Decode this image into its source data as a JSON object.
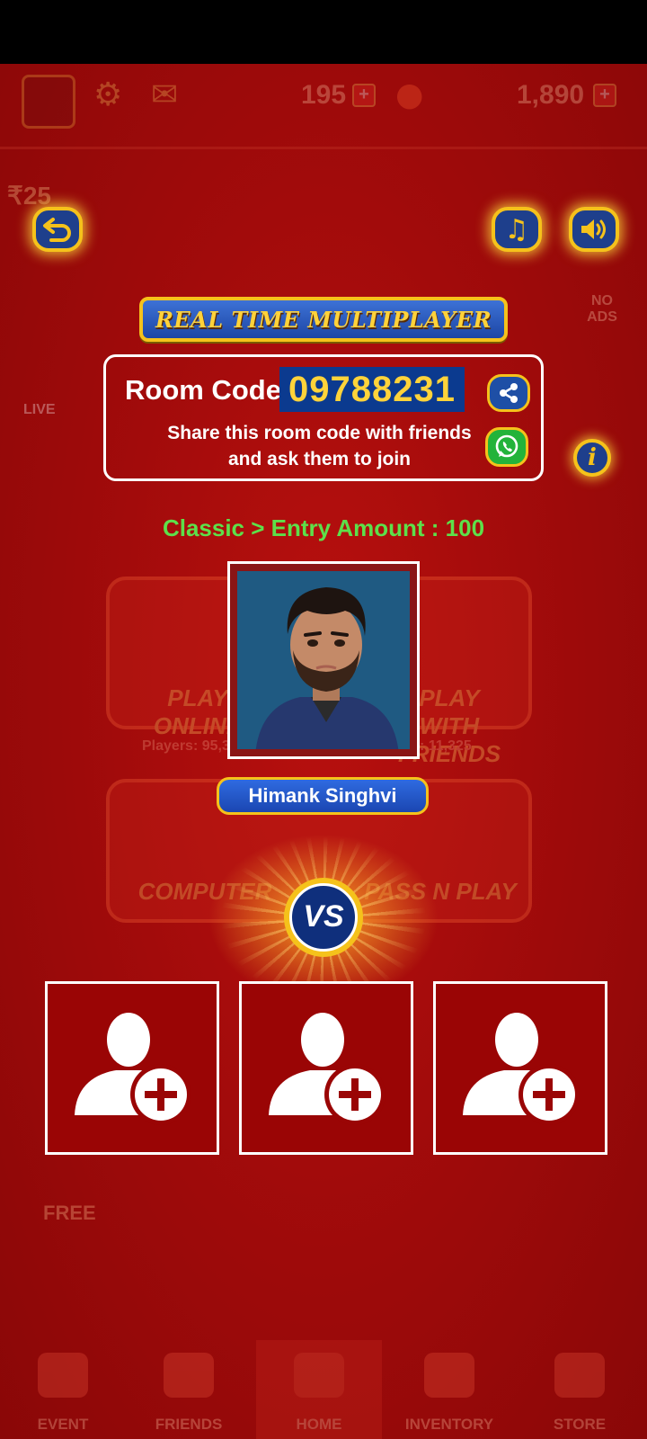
{
  "background": {
    "header_coins": "195",
    "header_gems": "1,890",
    "rupee_badge": "₹25",
    "no_ads": "NO ADS",
    "live_label": "LIVE",
    "cards": {
      "play_online": "PLAY ONLINE",
      "play_friends": "PLAY WITH FRIENDS",
      "players_online": "Players: 95,386",
      "players_friends": "Players: 11,325",
      "computer": "COMPUTER",
      "pass_n_play": "PASS N PLAY"
    },
    "free_label": "FREE",
    "tabs": [
      "EVENT",
      "FRIENDS",
      "HOME",
      "INVENTORY",
      "STORE"
    ]
  },
  "toolbar": {
    "back_icon": "back-arrow-icon",
    "music_icon": "music-note-icon",
    "sound_icon": "speaker-icon"
  },
  "banner": {
    "title": "REAL TIME MULTIPLAYER"
  },
  "room": {
    "label": "Room Code :",
    "code": "09788231",
    "hint_line1": "Share this room code with friends",
    "hint_line2": "and ask them to join"
  },
  "mode_text": "Classic > Entry Amount : 100",
  "player": {
    "name": "Himank Singhvi"
  },
  "vs_label": "VS",
  "slots": [
    {
      "icon": "add-user-icon"
    },
    {
      "icon": "add-user-icon"
    },
    {
      "icon": "add-user-icon"
    }
  ],
  "colors": {
    "background": "#a50c0c",
    "accent_gold": "#f5c21b",
    "button_blue": "#1e3f8c",
    "mode_green": "#5de04a",
    "code_bg": "#0b3a8f",
    "whatsapp_green": "#23b33a"
  }
}
